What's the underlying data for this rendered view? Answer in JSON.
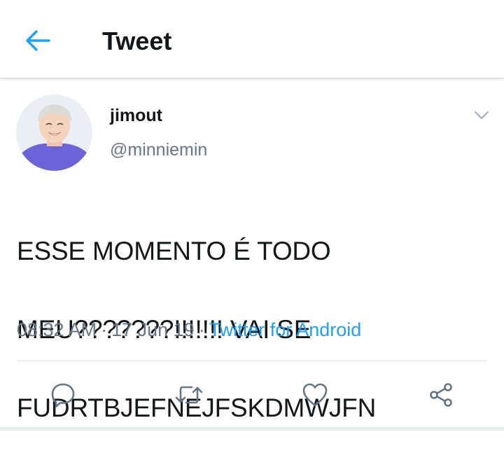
{
  "header": {
    "title": "Tweet",
    "back_icon": "arrow-left-icon"
  },
  "tweet": {
    "display_name": "jimout",
    "handle": "@minniemin",
    "text_lines": [
      "ESSE MOMENTO É TODO",
      "MEU???????!!!!!!! VAI SE",
      "FUDRTBJEFNEJFSKDMWJFN"
    ],
    "time": "08:32 AM",
    "separator": "·",
    "date": "17 Jun 19",
    "source": "Twitter for Android"
  },
  "actions": {
    "reply_icon": "reply-icon",
    "retweet_icon": "retweet-icon",
    "like_icon": "heart-icon",
    "share_icon": "share-icon"
  },
  "colors": {
    "accent": "#1da1f2",
    "text_primary": "#14171a",
    "text_secondary": "#657786",
    "icon_gray": "#657786",
    "divider": "#e1e8ed"
  }
}
